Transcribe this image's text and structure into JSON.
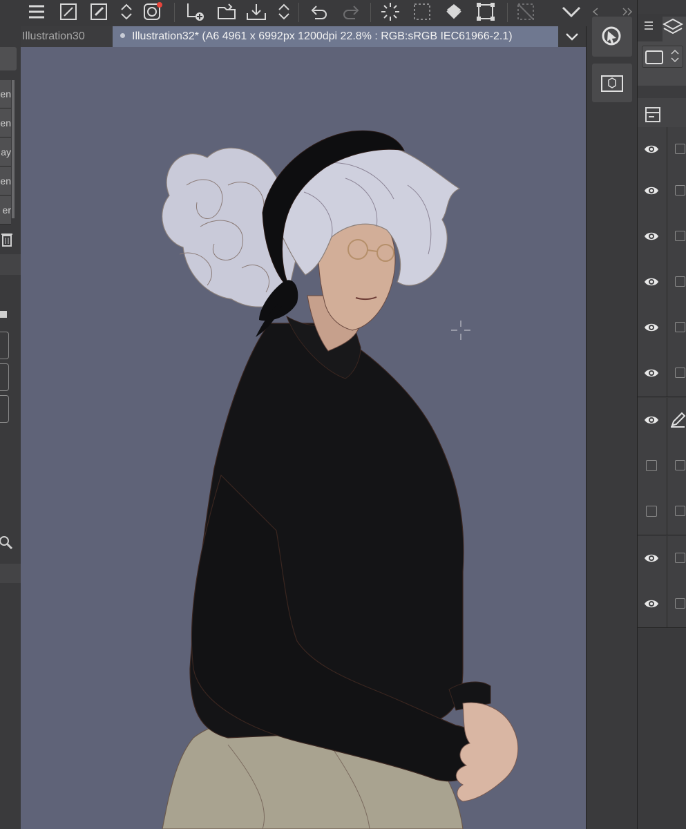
{
  "toolbar": {
    "icons": [
      "menu-icon",
      "resize-icon",
      "eyedropper-icon",
      "chevron-updown-icon",
      "spiral-icon",
      "new-layer-icon",
      "folder-open-icon",
      "export-icon",
      "chevron-updown-icon",
      "undo-icon",
      "redo-icon",
      "selection-sparkle-icon",
      "dashed-rect-icon",
      "fill-bucket-icon",
      "transform-icon",
      "crop-icon",
      "chevron-down-icon"
    ],
    "accent_dot": "#e8453c"
  },
  "tabs": {
    "inactive_label": "Illustration30",
    "active_label": "Illustration32* (A6 4961 x 6992px 1200dpi 22.8% : RGB:sRGB IEC61966-2.1)",
    "menu_icon": "chevron-down-icon"
  },
  "left_panel": {
    "fragments": [
      "en",
      "en",
      "ay",
      "en",
      "er"
    ]
  },
  "canvas": {
    "background": "#5f6378",
    "artwork": "character-illustration"
  },
  "layers": {
    "rows": [
      {
        "visible": true
      },
      {
        "visible": true
      },
      {
        "visible": true
      },
      {
        "visible": true
      },
      {
        "visible": true
      },
      {
        "visible": true
      },
      {
        "visible": true,
        "editing": true
      },
      {
        "visible": false
      },
      {
        "visible": false
      },
      {
        "visible": true
      },
      {
        "visible": true
      }
    ]
  }
}
